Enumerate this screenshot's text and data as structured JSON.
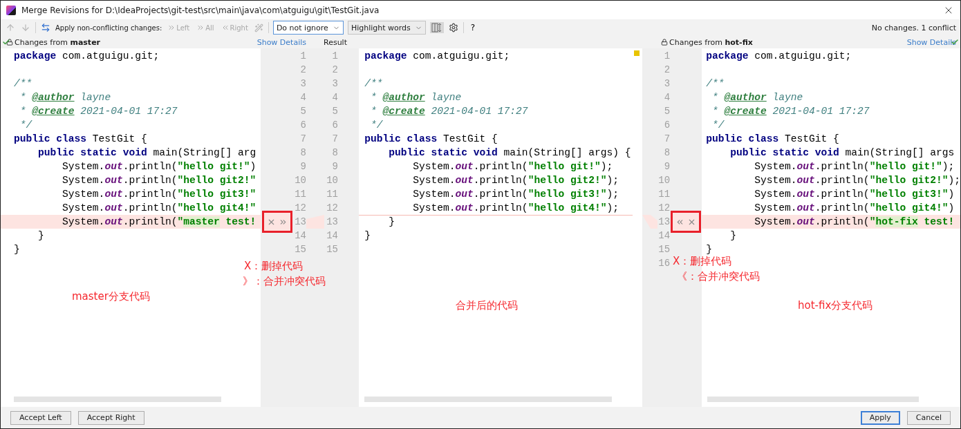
{
  "window": {
    "title": "Merge Revisions for D:\\IdeaProjects\\git-test\\src\\main\\java\\com\\atguigu\\git\\TestGit.java"
  },
  "toolbar": {
    "apply_label": "Apply non-conflicting changes:",
    "apply_buttons": [
      {
        "kind": "left",
        "label": "Left",
        "disabled": true
      },
      {
        "kind": "all",
        "label": "All",
        "disabled": true
      },
      {
        "kind": "right",
        "label": "Right",
        "disabled": true
      }
    ],
    "selects": [
      {
        "value": "Do not ignore",
        "focused": true
      },
      {
        "value": "Highlight words",
        "focused": false
      }
    ],
    "sync_scroll_pressed": true,
    "help": "?",
    "status": "No changes. 1 conflict"
  },
  "headers": {
    "master_pane": {
      "prefix": "Changes from ",
      "branch": "master",
      "link": "Show Details"
    },
    "result": "Result",
    "hotfix_pane": {
      "prefix": "Changes from ",
      "branch": "hot-fix",
      "link": "Show Details"
    }
  },
  "left_editor": {
    "lines": [
      {
        "conflict": false,
        "tokens": [
          {
            "kind": "kw",
            "text": "package"
          },
          {
            "kind": "plain",
            "text": " com.atguigu.git;"
          }
        ]
      },
      {
        "conflict": false
      },
      {
        "conflict": false,
        "tokens": [
          {
            "kind": "comment",
            "text": "/**"
          }
        ]
      },
      {
        "conflict": false,
        "tokens": [
          {
            "kind": "comment",
            "text": " * "
          },
          {
            "kind": "doctag",
            "text": "@author"
          },
          {
            "kind": "docval",
            "text": " layne"
          }
        ]
      },
      {
        "conflict": false,
        "tokens": [
          {
            "kind": "comment",
            "text": " * "
          },
          {
            "kind": "doctag",
            "text": "@create"
          },
          {
            "kind": "docval",
            "text": " 2021-04-01 17:27"
          }
        ]
      },
      {
        "conflict": false,
        "tokens": [
          {
            "kind": "comment",
            "text": " */"
          }
        ]
      },
      {
        "conflict": false,
        "tokens": [
          {
            "kind": "kw",
            "text": "public"
          },
          {
            "kind": "kw",
            "text": " class"
          },
          {
            "kind": "plain",
            "text": " TestGit {"
          }
        ]
      },
      {
        "conflict": false,
        "tokens": [
          {
            "kind": "kw",
            "text": "    public"
          },
          {
            "kind": "kw",
            "text": " static"
          },
          {
            "kind": "kw",
            "text": " void"
          },
          {
            "kind": "plain",
            "text": " main(String[] arg"
          }
        ]
      },
      {
        "conflict": false,
        "tokens": [
          {
            "kind": "plain",
            "text": "        System."
          },
          {
            "kind": "field",
            "text": "out"
          },
          {
            "kind": "plain",
            "text": ".println("
          },
          {
            "kind": "str",
            "text": "\"hello git!\""
          },
          {
            "kind": "plain",
            "text": ")"
          }
        ]
      },
      {
        "conflict": false,
        "tokens": [
          {
            "kind": "plain",
            "text": "        System."
          },
          {
            "kind": "field",
            "text": "out"
          },
          {
            "kind": "plain",
            "text": ".println("
          },
          {
            "kind": "str",
            "text": "\"hello git2!\""
          }
        ]
      },
      {
        "conflict": false,
        "tokens": [
          {
            "kind": "plain",
            "text": "        System."
          },
          {
            "kind": "field",
            "text": "out"
          },
          {
            "kind": "plain",
            "text": ".println("
          },
          {
            "kind": "str",
            "text": "\"hello git3!\""
          }
        ]
      },
      {
        "conflict": false,
        "tokens": [
          {
            "kind": "plain",
            "text": "        System."
          },
          {
            "kind": "field",
            "text": "out"
          },
          {
            "kind": "plain",
            "text": ".println("
          },
          {
            "kind": "str",
            "text": "\"hello git4!\""
          }
        ]
      },
      {
        "conflict": true,
        "tokens": [
          {
            "kind": "plain",
            "text": "        System."
          },
          {
            "kind": "field",
            "text": "out"
          },
          {
            "kind": "plain",
            "text": ".println("
          },
          {
            "kind": "str",
            "text": "\""
          },
          {
            "kind": "str_hl",
            "text": "master"
          },
          {
            "kind": "str",
            "text": " test!"
          }
        ]
      },
      {
        "conflict": false,
        "tokens": [
          {
            "kind": "plain",
            "text": "    }"
          }
        ]
      },
      {
        "conflict": false,
        "tokens": [
          {
            "kind": "plain",
            "text": "}"
          }
        ]
      }
    ]
  },
  "gutter_1": {
    "source_numbers": [
      "1",
      "2",
      "3",
      "4",
      "5",
      "6",
      "7",
      "8",
      "9",
      "10",
      "11",
      "12",
      "13",
      "14",
      "15"
    ],
    "result_numbers": [
      "1",
      "2",
      "3",
      "4",
      "5",
      "6",
      "7",
      "8",
      "9",
      "10",
      "11",
      "12",
      "13",
      "14",
      "15"
    ]
  },
  "result_editor": {
    "lines": [
      {
        "separator": false,
        "tokens": [
          {
            "kind": "kw",
            "text": "package"
          },
          {
            "kind": "plain",
            "text": " com.atguigu.git;"
          }
        ]
      },
      {
        "separator": false
      },
      {
        "separator": false,
        "tokens": [
          {
            "kind": "comment",
            "text": "/**"
          }
        ]
      },
      {
        "separator": false,
        "tokens": [
          {
            "kind": "comment",
            "text": " * "
          },
          {
            "kind": "doctag",
            "text": "@author"
          },
          {
            "kind": "docval",
            "text": " layne"
          }
        ]
      },
      {
        "separator": false,
        "tokens": [
          {
            "kind": "comment",
            "text": " * "
          },
          {
            "kind": "doctag",
            "text": "@create"
          },
          {
            "kind": "docval",
            "text": " 2021-04-01 17:27"
          }
        ]
      },
      {
        "separator": false,
        "tokens": [
          {
            "kind": "comment",
            "text": " */"
          }
        ]
      },
      {
        "separator": false,
        "tokens": [
          {
            "kind": "kw",
            "text": "public"
          },
          {
            "kind": "kw",
            "text": " class"
          },
          {
            "kind": "plain",
            "text": " TestGit {"
          }
        ]
      },
      {
        "separator": false,
        "tokens": [
          {
            "kind": "kw",
            "text": "    public"
          },
          {
            "kind": "kw",
            "text": " static"
          },
          {
            "kind": "kw",
            "text": " void"
          },
          {
            "kind": "plain",
            "text": " main(String[] args) {"
          }
        ]
      },
      {
        "separator": false,
        "tokens": [
          {
            "kind": "plain",
            "text": "        System."
          },
          {
            "kind": "field",
            "text": "out"
          },
          {
            "kind": "plain",
            "text": ".println("
          },
          {
            "kind": "str",
            "text": "\"hello git!\""
          },
          {
            "kind": "plain",
            "text": ");"
          }
        ]
      },
      {
        "separator": false,
        "tokens": [
          {
            "kind": "plain",
            "text": "        System."
          },
          {
            "kind": "field",
            "text": "out"
          },
          {
            "kind": "plain",
            "text": ".println("
          },
          {
            "kind": "str",
            "text": "\"hello git2!\""
          },
          {
            "kind": "plain",
            "text": ");"
          }
        ]
      },
      {
        "separator": false,
        "tokens": [
          {
            "kind": "plain",
            "text": "        System."
          },
          {
            "kind": "field",
            "text": "out"
          },
          {
            "kind": "plain",
            "text": ".println("
          },
          {
            "kind": "str",
            "text": "\"hello git3!\""
          },
          {
            "kind": "plain",
            "text": ");"
          }
        ]
      },
      {
        "separator": false,
        "tokens": [
          {
            "kind": "plain",
            "text": "        System."
          },
          {
            "kind": "field",
            "text": "out"
          },
          {
            "kind": "plain",
            "text": ".println("
          },
          {
            "kind": "str",
            "text": "\"hello git4!\""
          },
          {
            "kind": "plain",
            "text": ");"
          }
        ]
      },
      {
        "separator": true,
        "tokens": [
          {
            "kind": "plain",
            "text": "    }"
          }
        ]
      },
      {
        "separator": false,
        "tokens": [
          {
            "kind": "plain",
            "text": "}"
          }
        ]
      }
    ]
  },
  "gutter_2": {
    "numbers": [
      "1",
      "2",
      "3",
      "4",
      "5",
      "6",
      "7",
      "8",
      "9",
      "10",
      "11",
      "12",
      "13",
      "14",
      "15",
      "16"
    ]
  },
  "right_editor": {
    "lines": [
      {
        "conflict": false,
        "tokens": [
          {
            "kind": "kw",
            "text": "package"
          },
          {
            "kind": "plain",
            "text": " com.atguigu.git;"
          }
        ]
      },
      {
        "conflict": false
      },
      {
        "conflict": false,
        "tokens": [
          {
            "kind": "comment",
            "text": "/**"
          }
        ]
      },
      {
        "conflict": false,
        "tokens": [
          {
            "kind": "comment",
            "text": " * "
          },
          {
            "kind": "doctag",
            "text": "@author"
          },
          {
            "kind": "docval",
            "text": " layne"
          }
        ]
      },
      {
        "conflict": false,
        "tokens": [
          {
            "kind": "comment",
            "text": " * "
          },
          {
            "kind": "doctag",
            "text": "@create"
          },
          {
            "kind": "docval",
            "text": " 2021-04-01 17:27"
          }
        ]
      },
      {
        "conflict": false,
        "tokens": [
          {
            "kind": "comment",
            "text": " */"
          }
        ]
      },
      {
        "conflict": false,
        "tokens": [
          {
            "kind": "kw",
            "text": "public"
          },
          {
            "kind": "kw",
            "text": " class"
          },
          {
            "kind": "plain",
            "text": " TestGit {"
          }
        ]
      },
      {
        "conflict": false,
        "tokens": [
          {
            "kind": "kw",
            "text": "    public"
          },
          {
            "kind": "kw",
            "text": " static"
          },
          {
            "kind": "kw",
            "text": " void"
          },
          {
            "kind": "plain",
            "text": " main(String[] args"
          }
        ]
      },
      {
        "conflict": false,
        "tokens": [
          {
            "kind": "plain",
            "text": "        System."
          },
          {
            "kind": "field",
            "text": "out"
          },
          {
            "kind": "plain",
            "text": ".println("
          },
          {
            "kind": "str",
            "text": "\"hello git!\""
          },
          {
            "kind": "plain",
            "text": ");"
          }
        ]
      },
      {
        "conflict": false,
        "tokens": [
          {
            "kind": "plain",
            "text": "        System."
          },
          {
            "kind": "field",
            "text": "out"
          },
          {
            "kind": "plain",
            "text": ".println("
          },
          {
            "kind": "str",
            "text": "\"hello git2!\""
          },
          {
            "kind": "plain",
            "text": ");"
          }
        ]
      },
      {
        "conflict": false,
        "tokens": [
          {
            "kind": "plain",
            "text": "        System."
          },
          {
            "kind": "field",
            "text": "out"
          },
          {
            "kind": "plain",
            "text": ".println("
          },
          {
            "kind": "str",
            "text": "\"hello git3!\""
          },
          {
            "kind": "plain",
            "text": ")"
          }
        ]
      },
      {
        "conflict": false,
        "tokens": [
          {
            "kind": "plain",
            "text": "        System."
          },
          {
            "kind": "field",
            "text": "out"
          },
          {
            "kind": "plain",
            "text": ".println("
          },
          {
            "kind": "str",
            "text": "\"hello git4!\""
          },
          {
            "kind": "plain",
            "text": ")"
          }
        ]
      },
      {
        "conflict": true,
        "tokens": [
          {
            "kind": "plain",
            "text": "        System."
          },
          {
            "kind": "field",
            "text": "out"
          },
          {
            "kind": "plain",
            "text": ".println("
          },
          {
            "kind": "str",
            "text": "\""
          },
          {
            "kind": "str_hl",
            "text": "hot-fix"
          },
          {
            "kind": "str",
            "text": " test!"
          }
        ]
      },
      {
        "conflict": false,
        "tokens": [
          {
            "kind": "plain",
            "text": "    }"
          }
        ]
      },
      {
        "conflict": false,
        "tokens": [
          {
            "kind": "plain",
            "text": "}"
          }
        ]
      }
    ]
  },
  "annotations": [
    {
      "text": "X：删掉代码"
    },
    {
      "text": "》：合并冲突代码"
    },
    {
      "text": "master分支代码"
    },
    {
      "text": "合并后的代码"
    },
    {
      "text": "hot-fix分支代码"
    },
    {
      "text": "X：删掉代码"
    },
    {
      "text": "《：合并冲突代码"
    }
  ],
  "footer": {
    "left_buttons": [
      {
        "label": "Accept Left",
        "default": false
      },
      {
        "label": "Accept Right",
        "default": false
      }
    ],
    "right_buttons": [
      {
        "label": "Apply",
        "default": true
      },
      {
        "label": "Cancel",
        "default": false
      }
    ]
  }
}
